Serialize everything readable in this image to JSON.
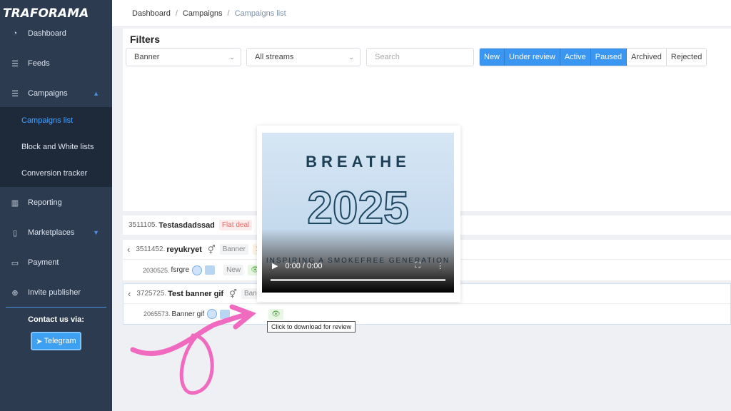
{
  "brand": {
    "logo": "TRAFORAMA"
  },
  "sidebar": {
    "items": [
      {
        "label": "Dashboard",
        "icon": "dashboard-icon"
      },
      {
        "label": "Feeds",
        "icon": "sliders-icon"
      },
      {
        "label": "Campaigns",
        "icon": "sliders-icon"
      },
      {
        "label": "Reporting",
        "icon": "chart-icon"
      },
      {
        "label": "Marketplaces",
        "icon": "tablet-icon"
      },
      {
        "label": "Payment",
        "icon": "card-icon"
      },
      {
        "label": "Invite publisher",
        "icon": "plus-circle-icon"
      }
    ],
    "sub": [
      "Campaigns list",
      "Block and White lists",
      "Conversion tracker"
    ],
    "contact": "Contact us via:",
    "telegram": "Telegram"
  },
  "breadcrumb": [
    "Dashboard",
    "Campaigns",
    "Campaigns list"
  ],
  "filters": {
    "title": "Filters",
    "type": "Banner",
    "stream": "All streams",
    "search_placeholder": "Search",
    "statuses": [
      {
        "label": "New",
        "active": true
      },
      {
        "label": "Under review",
        "active": true
      },
      {
        "label": "Active",
        "active": true
      },
      {
        "label": "Paused",
        "active": true
      },
      {
        "label": "Archived",
        "active": false
      },
      {
        "label": "Rejected",
        "active": false
      }
    ]
  },
  "rows": [
    {
      "id": "3511105.",
      "name": "Testasdadssad",
      "badge": "Flat deal",
      "type": "B"
    },
    {
      "id": "3511452.",
      "name": "reyukryet",
      "type": "Banner",
      "extra": "1"
    },
    {
      "id": "2030525.",
      "name": "fsrgre",
      "status": "New"
    },
    {
      "id": "3725725.",
      "name": "Test banner gif",
      "type": "Banne"
    },
    {
      "id": "2065573.",
      "name": "Banner gif"
    }
  ],
  "video": {
    "line1": "BREATHE",
    "line2": "2025",
    "line3": "INSPIRING A SMOKEFREE GENERATION",
    "time": "0:00 / 0:00"
  },
  "tooltip": "Click to download for review",
  "colors": {
    "accent": "#3a96f0",
    "sidebar": "#2c3b50",
    "annotation": "#f06ac0"
  }
}
